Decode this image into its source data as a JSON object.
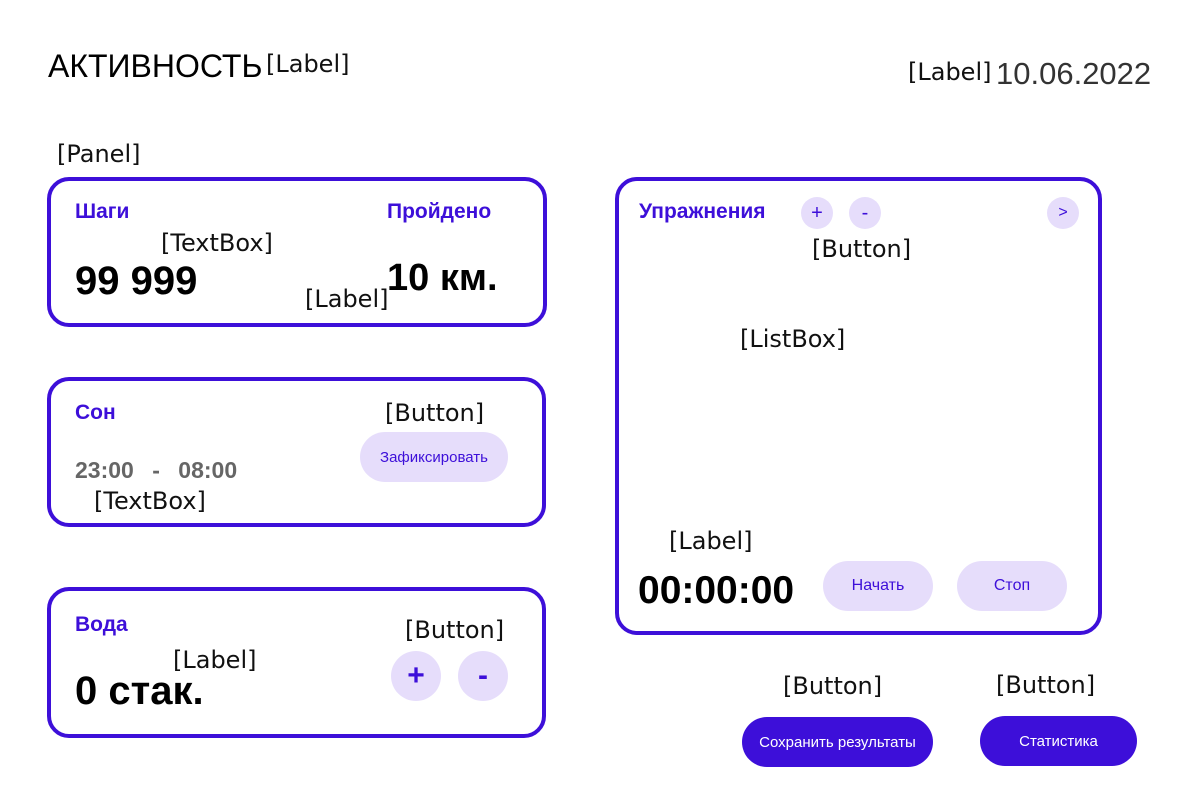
{
  "header": {
    "title": "АКТИВНОСТЬ",
    "title_anno": "[Label]",
    "date_anno": "[Label]",
    "date": "10.06.2022"
  },
  "panel_anno": "[Panel]",
  "steps_card": {
    "steps_label": "Шаги",
    "steps_anno": "[TextBox]",
    "steps_value": "99 999",
    "distance_label": "Пройдено",
    "distance_anno": "[Label]",
    "distance_value": "10 км."
  },
  "sleep_card": {
    "label": "Сон",
    "button_anno": "[Button]",
    "button_label": "Зафиксировать",
    "time_from": "23:00",
    "time_sep": "-",
    "time_to": "08:00",
    "time_anno": "[TextBox]"
  },
  "water_card": {
    "label": "Вода",
    "value_anno": "[Label]",
    "value": "0 стак.",
    "buttons_anno": "[Button]",
    "plus": "+",
    "minus": "-"
  },
  "exercise_card": {
    "label": "Упражнения",
    "plus": "+",
    "minus": "-",
    "next": ">",
    "buttons_anno": "[Button]",
    "listbox_anno": "[ListBox]",
    "timer_anno": "[Label]",
    "timer": "00:00:00",
    "start_label": "Начать",
    "stop_label": "Стоп"
  },
  "footer": {
    "save_anno": "[Button]",
    "save_label": "Сохранить результаты",
    "stats_anno": "[Button]",
    "stats_label": "Статистика"
  },
  "colors": {
    "accent": "#3d0fd9",
    "button_light": "#e6ddfb",
    "muted_text": "#666666"
  }
}
